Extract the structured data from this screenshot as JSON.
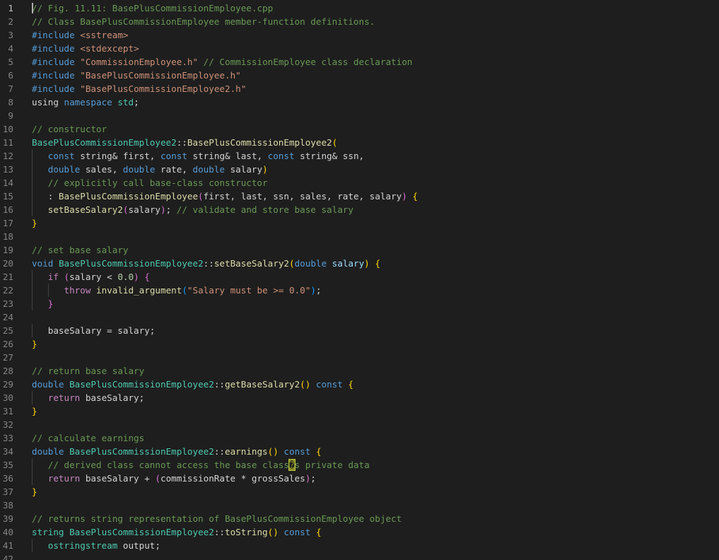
{
  "editor": {
    "theme": {
      "background": "#1e1e1e",
      "line_number": "#858585",
      "comment": "#6a9955",
      "keyword": "#569cd6",
      "function": "#dcdcaa",
      "type": "#4ec9b0",
      "string": "#ce9178",
      "variable": "#9cdcfe",
      "number": "#b5cea8"
    },
    "cursor_line": 1,
    "lines": [
      {
        "n": "1",
        "tokens": [
          [
            "cm",
            "// Fig. 11.11: BasePlusCommissionEmployee.cpp"
          ]
        ]
      },
      {
        "n": "2",
        "tokens": [
          [
            "cm",
            "// Class BasePlusCommissionEmployee member-function definitions."
          ]
        ]
      },
      {
        "n": "3",
        "tokens": [
          [
            "kw",
            "#include"
          ],
          [
            "op",
            " "
          ],
          [
            "inc",
            "<sstream>"
          ]
        ]
      },
      {
        "n": "4",
        "tokens": [
          [
            "kw",
            "#include"
          ],
          [
            "op",
            " "
          ],
          [
            "inc",
            "<stdexcept>"
          ]
        ]
      },
      {
        "n": "5",
        "tokens": [
          [
            "kw",
            "#include"
          ],
          [
            "op",
            " "
          ],
          [
            "str",
            "\"CommissionEmployee.h\""
          ],
          [
            "op",
            " "
          ],
          [
            "cm",
            "// CommissionEmployee class declaration"
          ]
        ]
      },
      {
        "n": "6",
        "tokens": [
          [
            "kw",
            "#include"
          ],
          [
            "op",
            " "
          ],
          [
            "str",
            "\"BasePlusCommissionEmployee.h\""
          ]
        ]
      },
      {
        "n": "7",
        "tokens": [
          [
            "kw",
            "#include"
          ],
          [
            "op",
            " "
          ],
          [
            "str",
            "\"BasePlusCommissionEmployee2.h\""
          ]
        ]
      },
      {
        "n": "8",
        "tokens": [
          [
            "op",
            "using "
          ],
          [
            "kw",
            "namespace"
          ],
          [
            "op",
            " "
          ],
          [
            "ty",
            "std"
          ],
          [
            "op",
            ";"
          ]
        ]
      },
      {
        "n": "9",
        "tokens": []
      },
      {
        "n": "10",
        "tokens": [
          [
            "cm",
            "// constructor"
          ]
        ]
      },
      {
        "n": "11",
        "tokens": [
          [
            "ty",
            "BasePlusCommissionEmployee2"
          ],
          [
            "op",
            "::"
          ],
          [
            "fn",
            "BasePlusCommissionEmployee2"
          ],
          [
            "br1",
            "("
          ]
        ]
      },
      {
        "n": "12",
        "indent": 1,
        "tokens": [
          [
            "kw",
            "const"
          ],
          [
            "op",
            " string& first, "
          ],
          [
            "kw",
            "const"
          ],
          [
            "op",
            " string& last, "
          ],
          [
            "kw",
            "const"
          ],
          [
            "op",
            " string& ssn,"
          ]
        ]
      },
      {
        "n": "13",
        "indent": 1,
        "tokens": [
          [
            "kw",
            "double"
          ],
          [
            "op",
            " sales, "
          ],
          [
            "kw",
            "double"
          ],
          [
            "op",
            " rate, "
          ],
          [
            "kw",
            "double"
          ],
          [
            "op",
            " salary"
          ],
          [
            "br1",
            ")"
          ]
        ]
      },
      {
        "n": "14",
        "indent": 1,
        "tokens": [
          [
            "cm",
            "// explicitly call base-class constructor"
          ]
        ]
      },
      {
        "n": "15",
        "indent": 1,
        "tokens": [
          [
            "op",
            ": "
          ],
          [
            "fn",
            "BasePlusCommissionEmployee"
          ],
          [
            "br2",
            "("
          ],
          [
            "op",
            "first, last, ssn, sales, rate, salary"
          ],
          [
            "br2",
            ")"
          ],
          [
            "op",
            " "
          ],
          [
            "br1",
            "{"
          ]
        ]
      },
      {
        "n": "16",
        "indent": 1,
        "tokens": [
          [
            "fn",
            "setBaseSalary2"
          ],
          [
            "br2",
            "("
          ],
          [
            "op",
            "salary"
          ],
          [
            "br2",
            ")"
          ],
          [
            "op",
            "; "
          ],
          [
            "cm",
            "// validate and store base salary"
          ]
        ]
      },
      {
        "n": "17",
        "tokens": [
          [
            "br1",
            "}"
          ]
        ]
      },
      {
        "n": "18",
        "tokens": []
      },
      {
        "n": "19",
        "tokens": [
          [
            "cm",
            "// set base salary"
          ]
        ]
      },
      {
        "n": "20",
        "tokens": [
          [
            "kw",
            "void"
          ],
          [
            "op",
            " "
          ],
          [
            "ty",
            "BasePlusCommissionEmployee2"
          ],
          [
            "op",
            "::"
          ],
          [
            "fn",
            "setBaseSalary2"
          ],
          [
            "br1",
            "("
          ],
          [
            "kw",
            "double"
          ],
          [
            "op",
            " "
          ],
          [
            "var",
            "salary"
          ],
          [
            "br1",
            ")"
          ],
          [
            "op",
            " "
          ],
          [
            "br1",
            "{"
          ]
        ]
      },
      {
        "n": "21",
        "indent": 1,
        "tokens": [
          [
            "pp",
            "if"
          ],
          [
            "op",
            " "
          ],
          [
            "br2",
            "("
          ],
          [
            "op",
            "salary < "
          ],
          [
            "num",
            "0.0"
          ],
          [
            "br2",
            ")"
          ],
          [
            "op",
            " "
          ],
          [
            "br2",
            "{"
          ]
        ]
      },
      {
        "n": "22",
        "indent": 2,
        "tokens": [
          [
            "pp",
            "throw"
          ],
          [
            "op",
            " "
          ],
          [
            "fn",
            "invalid_argument"
          ],
          [
            "br3",
            "("
          ],
          [
            "str",
            "\"Salary must be >= 0.0\""
          ],
          [
            "br3",
            ")"
          ],
          [
            "op",
            ";"
          ]
        ]
      },
      {
        "n": "23",
        "indent": 1,
        "tokens": [
          [
            "br2",
            "}"
          ]
        ]
      },
      {
        "n": "24",
        "tokens": []
      },
      {
        "n": "25",
        "indent": 1,
        "tokens": [
          [
            "op",
            "baseSalary = salary;"
          ]
        ]
      },
      {
        "n": "26",
        "tokens": [
          [
            "br1",
            "}"
          ]
        ]
      },
      {
        "n": "27",
        "tokens": []
      },
      {
        "n": "28",
        "tokens": [
          [
            "cm",
            "// return base salary"
          ]
        ]
      },
      {
        "n": "29",
        "tokens": [
          [
            "kw",
            "double"
          ],
          [
            "op",
            " "
          ],
          [
            "ty",
            "BasePlusCommissionEmployee2"
          ],
          [
            "op",
            "::"
          ],
          [
            "fn",
            "getBaseSalary2"
          ],
          [
            "br1",
            "()"
          ],
          [
            "op",
            " "
          ],
          [
            "kw",
            "const"
          ],
          [
            "op",
            " "
          ],
          [
            "br1",
            "{"
          ]
        ]
      },
      {
        "n": "30",
        "indent": 1,
        "tokens": [
          [
            "pp",
            "return"
          ],
          [
            "op",
            " baseSalary;"
          ]
        ]
      },
      {
        "n": "31",
        "tokens": [
          [
            "br1",
            "}"
          ]
        ]
      },
      {
        "n": "32",
        "tokens": []
      },
      {
        "n": "33",
        "tokens": [
          [
            "cm",
            "// calculate earnings"
          ]
        ]
      },
      {
        "n": "34",
        "tokens": [
          [
            "kw",
            "double"
          ],
          [
            "op",
            " "
          ],
          [
            "ty",
            "BasePlusCommissionEmployee2"
          ],
          [
            "op",
            "::"
          ],
          [
            "fn",
            "earnings"
          ],
          [
            "br1",
            "()"
          ],
          [
            "op",
            " "
          ],
          [
            "kw",
            "const"
          ],
          [
            "op",
            " "
          ],
          [
            "br1",
            "{"
          ]
        ]
      },
      {
        "n": "35",
        "indent": 1,
        "tokens": [
          [
            "cm",
            "// derived class cannot access the base class"
          ],
          [
            "bad",
            "�"
          ],
          [
            "cm",
            "s private data"
          ]
        ]
      },
      {
        "n": "36",
        "indent": 1,
        "tokens": [
          [
            "pp",
            "return"
          ],
          [
            "op",
            " baseSalary + "
          ],
          [
            "br2",
            "("
          ],
          [
            "op",
            "commissionRate * grossSales"
          ],
          [
            "br2",
            ")"
          ],
          [
            "op",
            ";"
          ]
        ]
      },
      {
        "n": "37",
        "tokens": [
          [
            "br1",
            "}"
          ]
        ]
      },
      {
        "n": "38",
        "tokens": []
      },
      {
        "n": "39",
        "tokens": [
          [
            "cm",
            "// returns string representation of BasePlusCommissionEmployee object"
          ]
        ]
      },
      {
        "n": "40",
        "tokens": [
          [
            "ty",
            "string"
          ],
          [
            "op",
            " "
          ],
          [
            "ty",
            "BasePlusCommissionEmployee2"
          ],
          [
            "op",
            "::"
          ],
          [
            "fn",
            "toString"
          ],
          [
            "br1",
            "()"
          ],
          [
            "op",
            " "
          ],
          [
            "kw",
            "const"
          ],
          [
            "op",
            " "
          ],
          [
            "br1",
            "{"
          ]
        ]
      },
      {
        "n": "41",
        "indent": 1,
        "tokens": [
          [
            "ty",
            "ostringstream"
          ],
          [
            "op",
            " output;"
          ]
        ]
      },
      {
        "n": "42",
        "tokens": []
      }
    ]
  }
}
